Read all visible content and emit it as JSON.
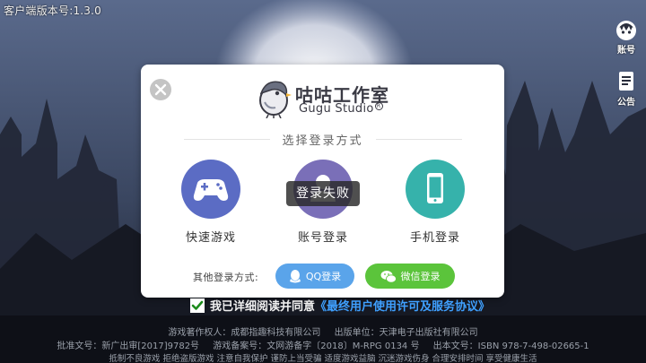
{
  "version_text": "客户端版本号:1.3.0",
  "side": {
    "account_label": "账号",
    "notice_label": "公告"
  },
  "dialog": {
    "brand_title": "咕咕工作室",
    "brand_sub": "Gugu Studio",
    "brand_badge": "R",
    "section_title": "选择登录方式",
    "options": [
      {
        "label": "快速游戏",
        "color": "#5b6cc4"
      },
      {
        "label": "账号登录",
        "color": "#7a6fb8"
      },
      {
        "label": "手机登录",
        "color": "#36b2ab"
      }
    ],
    "other_label": "其他登录方式:",
    "qq_label": "QQ登录",
    "qq_color": "#5aa4ea",
    "wechat_label": "微信登录",
    "wechat_color": "#5bc43b",
    "toast": "登录失败"
  },
  "agreement": {
    "text": "我已详细阅读并同意",
    "link": "《最终用户使用许可及服务协议》"
  },
  "footer": {
    "line1": [
      "游戏著作权人：成都指趣科技有限公司",
      "出版单位：天津电子出版社有限公司"
    ],
    "line2": [
      "批准文号：新广出审[2017]9782号",
      "游戏备案号：文网游备字〔2018〕M-RPG 0134 号",
      "出本文号：ISBN 978-7-498-02665-1"
    ],
    "line3": "抵制不良游戏  拒绝盗版游戏  注意自我保护  谨防上当受骗  适度游戏益脑  沉迷游戏伤身  合理安排时间  享受健康生活"
  }
}
